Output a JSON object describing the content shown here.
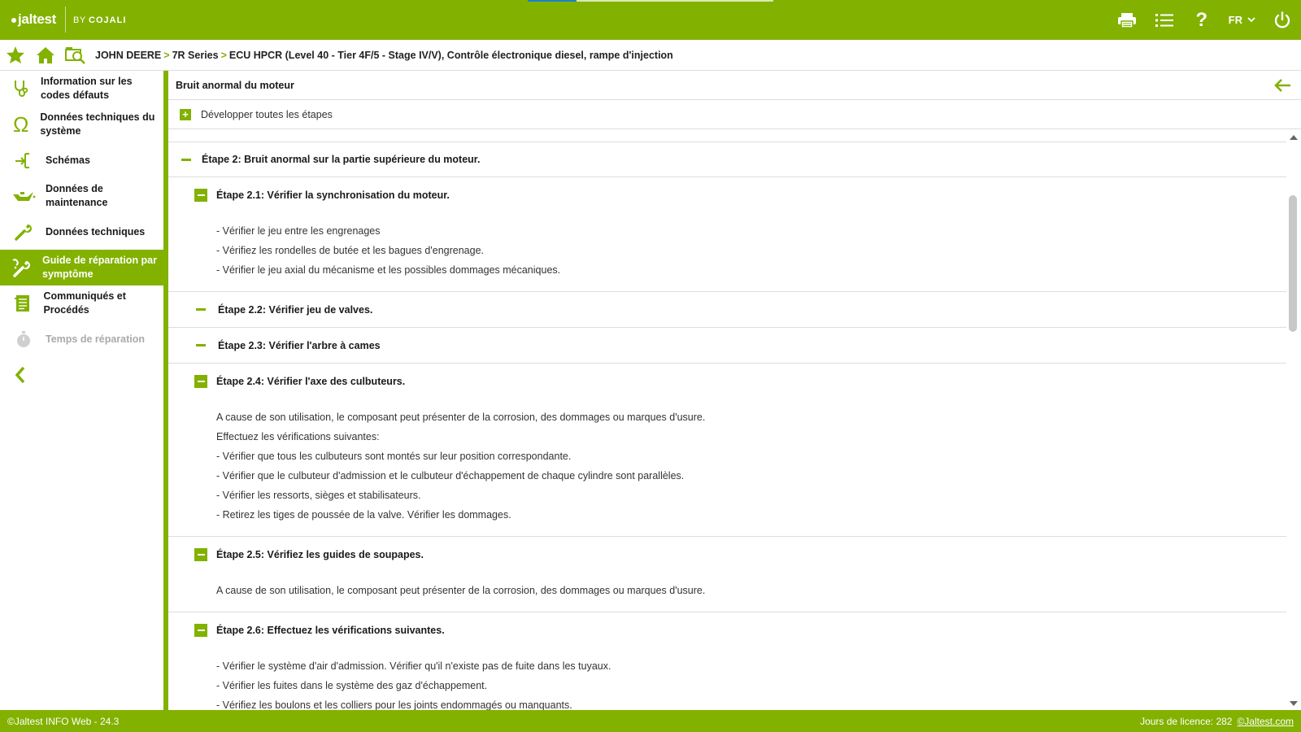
{
  "brand": {
    "logo": "jaltest",
    "by": "BY",
    "company": "COJALI"
  },
  "topbar": {
    "language": "FR",
    "icons": [
      "printer-icon",
      "list-icon",
      "help-icon",
      "chevron-down-icon",
      "power-icon"
    ]
  },
  "breadcrumb": {
    "items": [
      "JOHN DEERE",
      "7R Series",
      "ECU HPCR (Level 40 - Tier 4F/5 - Stage IV/V), Contrôle électronique diesel, rampe d'injection"
    ],
    "separator": ">"
  },
  "sidebar": {
    "items": [
      {
        "label": "Information sur les codes défauts",
        "icon": "stethoscope-icon",
        "state": "normal"
      },
      {
        "label": "Données techniques du système",
        "icon": "omega-icon",
        "state": "normal"
      },
      {
        "label": "Schémas",
        "icon": "schematic-icon",
        "state": "normal"
      },
      {
        "label": "Données de maintenance",
        "icon": "oil-can-icon",
        "state": "normal"
      },
      {
        "label": "Données techniques",
        "icon": "wrench-icon",
        "state": "normal"
      },
      {
        "label": "Guide de réparation par symptôme",
        "icon": "repair-guide-icon",
        "state": "active"
      },
      {
        "label": "Communiqués et Procédés",
        "icon": "document-icon",
        "state": "normal"
      },
      {
        "label": "Temps de réparation",
        "icon": "stopwatch-icon",
        "state": "disabled"
      }
    ]
  },
  "main": {
    "title": "Bruit anormal du moteur",
    "expand_all": "Développer toutes les étapes",
    "step": "Étape 2: Bruit anormal sur la partie supérieure du moteur.",
    "substeps": [
      {
        "label": "Étape 2.1: Vérifier la synchronisation du moteur.",
        "expanded": true,
        "lines": [
          "- Vérifier le jeu entre les engrenages",
          "- Vérifiez les rondelles de butée et les bagues d'engrenage.",
          "- Vérifier le jeu axial du mécanisme et les possibles dommages mécaniques."
        ]
      },
      {
        "label": "Étape 2.2: Vérifier jeu de valves.",
        "expanded": false,
        "lines": []
      },
      {
        "label": "Étape 2.3: Vérifier l'arbre à cames",
        "expanded": false,
        "lines": []
      },
      {
        "label": "Étape 2.4: Vérifier l'axe des culbuteurs.",
        "expanded": true,
        "lines": [
          "A cause de son utilisation, le composant peut présenter de la corrosion, des dommages ou marques d'usure.",
          "Effectuez les vérifications suivantes:",
          "- Vérifier que tous les culbuteurs sont montés sur leur position correspondante.",
          "- Vérifier que le culbuteur d'admission et le culbuteur d'échappement de chaque cylindre sont parallèles.",
          "- Vérifier les ressorts, sièges et stabilisateurs.",
          "- Retirez les tiges de poussée de la valve. Vérifier les dommages."
        ]
      },
      {
        "label": "Étape 2.5: Vérifiez les guides de soupapes.",
        "expanded": true,
        "lines": [
          "A cause de son utilisation, le composant peut présenter de la corrosion, des dommages ou marques d'usure."
        ]
      },
      {
        "label": "Étape 2.6: Effectuez les vérifications suivantes.",
        "expanded": true,
        "lines": [
          "- Vérifier le système d'air d'admission. Vérifier qu'il n'existe pas de fuite dans les tuyaux.",
          "- Vérifier les fuites dans le système des gaz d'échappement.",
          "- Vérifiez les boulons et les colliers pour les joints endommagés ou manquants."
        ]
      }
    ]
  },
  "footer": {
    "version": "©Jaltest INFO Web - 24.3",
    "license": "Jours de licence: 282",
    "link": "©Jaltest.com"
  },
  "colors": {
    "accent": "#82b100",
    "progress": "#1e7fc8"
  }
}
